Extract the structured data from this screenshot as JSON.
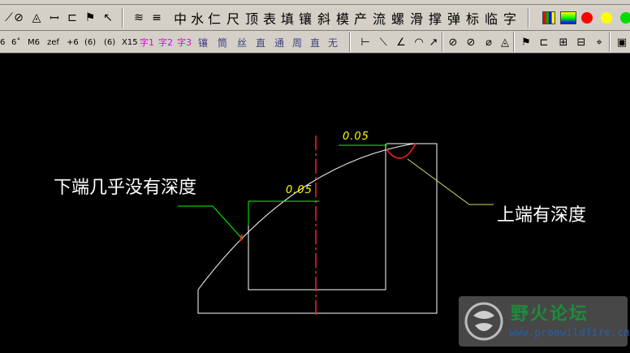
{
  "toolbar1": {
    "chinese_tools": [
      "中",
      "水",
      "仁",
      "尺",
      "顶",
      "表",
      "填",
      "镶",
      "斜",
      "模",
      "产",
      "流",
      "螺",
      "滑",
      "撑",
      "弹",
      "标",
      "临",
      "字"
    ]
  },
  "toolbar2": {
    "snap_labels": [
      "6",
      "6˚",
      "M6",
      "zef",
      "+6",
      "(6)",
      "(6)",
      "X15"
    ],
    "text_tools": [
      "字1",
      "字2",
      "字3"
    ],
    "dim_tools": [
      "镶",
      "筒",
      "丝",
      "直",
      "通",
      "周",
      "直",
      "无"
    ]
  },
  "canvas": {
    "annotation_left": "下端几乎没有深度",
    "annotation_right": "上端有深度",
    "dim_top": "0.05",
    "dim_mid": "0.05"
  },
  "watermark": {
    "title": "野火论坛",
    "url": "www.proewildfire.cn"
  },
  "colors": {
    "toolbar_bg": "#d4d0c8",
    "canvas_bg": "#000000",
    "dimension": "#ffff00",
    "leader": "#00ff00",
    "centerline": "#ff0000"
  }
}
